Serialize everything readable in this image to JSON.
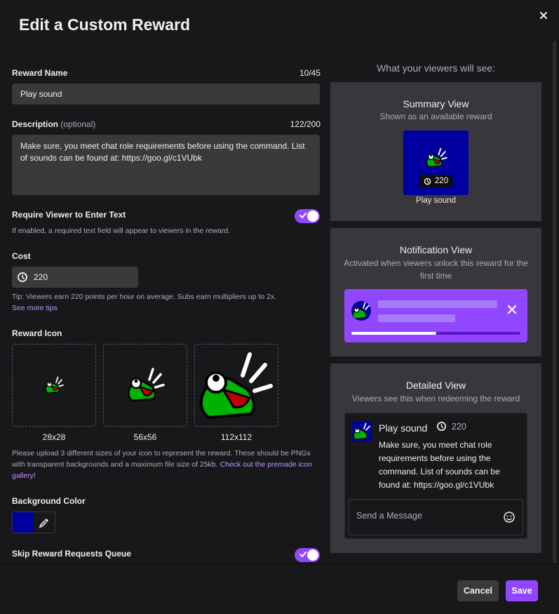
{
  "dialog": {
    "title": "Edit a Custom Reward",
    "close_icon": "close-icon"
  },
  "form": {
    "reward_name": {
      "label": "Reward Name",
      "count": "10/45",
      "value": "Play sound"
    },
    "description": {
      "label": "Description",
      "optional": "(optional)",
      "count": "122/200",
      "value": "Make sure, you meet chat role requirements before using the command. List of sounds can be found at: https://goo.gl/c1VUbk"
    },
    "require_text": {
      "label": "Require Viewer to Enter Text",
      "help": "If enabled, a required text field will appear to viewers in the reward.",
      "enabled": true
    },
    "cost": {
      "label": "Cost",
      "value": "220",
      "icon": "channel-points-icon",
      "tip": "Tip: Viewers earn 220 points per hour on average. Subs earn multipliers up to 2x.",
      "tip_link": "See more tips"
    },
    "reward_icon": {
      "label": "Reward Icon",
      "sizes": [
        "28x28",
        "56x56",
        "112x112"
      ],
      "help": "Please upload 3 different sizes of your icon to represent the reward. These should be PNGs with transparent backgrounds and a maximum file size of 25kb. ",
      "help_link": "Check out the premade icon gallery!"
    },
    "background_color": {
      "label": "Background Color",
      "value": "#0000a0",
      "icon": "eyedropper-icon"
    },
    "skip_queue": {
      "label": "Skip Reward Requests Queue",
      "enabled": true
    }
  },
  "preview": {
    "heading": "What your viewers will see:",
    "summary": {
      "title": "Summary View",
      "subtitle": "Shown as an available reward",
      "cost": "220",
      "name": "Play sound"
    },
    "notification": {
      "title": "Notification View",
      "subtitle": "Activated when viewers unlock this reward for the first time",
      "progress": 0.5
    },
    "detailed": {
      "title": "Detailed View",
      "subtitle": "Viewers see this when redeeming the reward",
      "name": "Play sound",
      "cost": "220",
      "description": "Make sure, you meet chat role requirements before using the command. List of sounds can be found at: https://goo.gl/c1VUbk",
      "chat_placeholder": "Send a Message"
    }
  },
  "footer": {
    "cancel": "Cancel",
    "save": "Save"
  },
  "colors": {
    "accent": "#9147ff",
    "tile_bg": "#0000a0",
    "panel_bg": "#37373c",
    "modal_bg": "#18181b"
  }
}
